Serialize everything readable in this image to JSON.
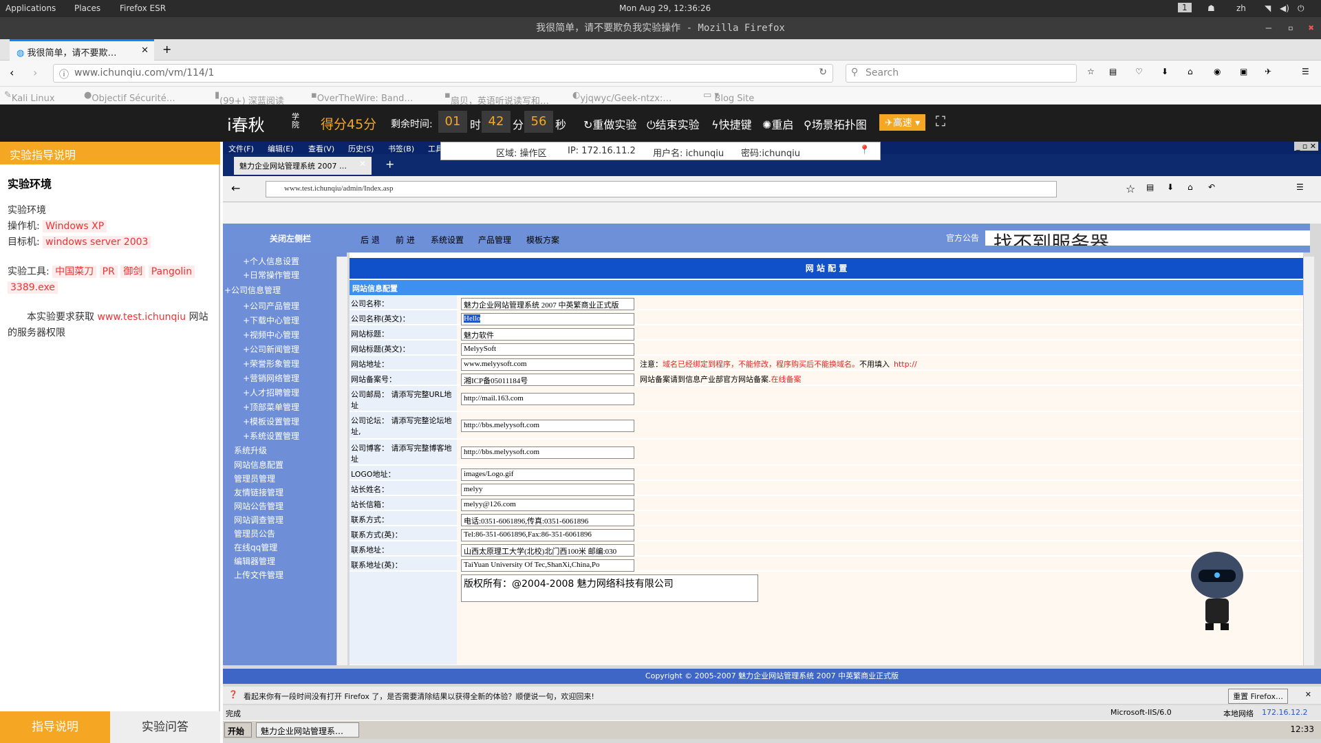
{
  "gnome": {
    "apps": "Applications",
    "places": "Places",
    "firefox": "Firefox ESR",
    "clock": "Mon Aug 29, 12:36:26",
    "workspace": "1",
    "lang": "zh"
  },
  "window_title": "我很简单，请不要欺负我实验操作 - Mozilla Firefox",
  "tab_label": "我很简单，请不要欺…",
  "url": "www.ichunqiu.com/vm/114/1",
  "search_placeholder": "Search",
  "bookmarks": [
    "Kali Linux",
    "Objectif Sécurité…",
    "(99+) 深蓝阅读",
    "OverTheWire: Band…",
    "扇贝，英语听说读写和…",
    "yjqwyc/Geek-ntzx:…",
    "Blog Site"
  ],
  "ichunqiu": {
    "logo": "i春秋",
    "logo_sub": "学院",
    "score": "得分45分",
    "remaining": "剩余时间:",
    "h": "01",
    "h_unit": "时",
    "m": "42",
    "m_unit": "分",
    "s": "56",
    "s_unit": "秒",
    "redo": "重做实验",
    "end": "结束实验",
    "shortcut": "快捷键",
    "restart": "重启",
    "topo": "场景拓扑图",
    "speed": "高速"
  },
  "left": {
    "header": "实验指导说明",
    "env_title": "实验环境",
    "env_label": "实验环境",
    "op_label": "操作机:",
    "op_value": "Windows XP",
    "target_label": "目标机:",
    "target_value": "windows server 2003",
    "tools_label": "实验工具:",
    "tools": [
      "中国菜刀",
      "PR",
      "御剑",
      "Pangolin",
      "3389.exe"
    ],
    "task_pre": "本实验要求获取",
    "task_link": "www.test.ichunqiu",
    "task_post": "网站的服务器权限",
    "tab_guide": "指导说明",
    "tab_qa": "实验问答"
  },
  "vm": {
    "menu": [
      "文件(F)",
      "编辑(E)",
      "查看(V)",
      "历史(S)",
      "书签(B)",
      "工具"
    ],
    "info": {
      "zone": "区域: 操作区",
      "ip": "IP: 172.16.11.2",
      "user": "用户名: ichunqiu",
      "pwd": "密码:ichunqiu"
    },
    "tab": "魅力企业网站管理系统 2007 …",
    "url": "www.test.ichunqiu/admin/Index.asp",
    "admin_top": {
      "close_left": "关闭左侧栏",
      "back": "后 退",
      "forward": "前 进",
      "sys": "系统设置",
      "product": "产品管理",
      "template": "模板方案",
      "notice": "官方公告",
      "marquee": "找不到服务器"
    },
    "sidebar": [
      "+个人信息设置",
      "+日常操作管理",
      "+公司信息管理",
      "+公司产品管理",
      "+下载中心管理",
      "+视频中心管理",
      "+公司新闻管理",
      "+荣誉形象管理",
      "+营销网络管理",
      "+人才招聘管理",
      "+顶部菜单管理",
      "+模板设置管理",
      "+系统设置管理",
      "系统升级",
      "网站信息配置",
      "管理员管理",
      "友情链接管理",
      "网站公告管理",
      "网站调查管理",
      "管理员公告",
      "在线qq管理",
      "编辑器管理",
      "上传文件管理"
    ],
    "title": "网 站 配 置",
    "section": "网站信息配置",
    "rows": [
      {
        "label": "公司名称：",
        "value": "魅力企业网站管理系统 2007 中英繁商业正式版"
      },
      {
        "label": "公司名称(英文)：",
        "value": "Hello"
      },
      {
        "label": "网站标题：",
        "value": "魅力软件"
      },
      {
        "label": "网站标题(英文)：",
        "value": "MelyySoft"
      },
      {
        "label": "网站地址：",
        "value": "www.melyysoft.com",
        "note": "注意：",
        "note_red": "域名已经绑定到程序，不能修改，程序购买后不能换域名。",
        "note2": "不用填入",
        "note_red2": "http://"
      },
      {
        "label": "网站备案号：",
        "value": "湘ICP备05011184号",
        "note": "网站备案请到信息产业部官方网站备案.",
        "note_red": "在线备案"
      },
      {
        "label": "公司邮局： 请添写完整URL地址",
        "value": "http://mail.163.com"
      },
      {
        "label": "公司论坛： 请添写完整论坛地址,",
        "value": "http://bbs.melyysoft.com"
      },
      {
        "label": "公司博客： 请添写完整博客地址",
        "value": "http://bbs.melyysoft.com"
      },
      {
        "label": "LOGO地址：",
        "value": "images/Logo.gif"
      },
      {
        "label": "站长姓名：",
        "value": "melyy"
      },
      {
        "label": "站长信箱：",
        "value": "melyy@126.com"
      },
      {
        "label": "联系方式：",
        "value": "电话:0351-6061896,传真:0351-6061896"
      },
      {
        "label": "联系方式(英)：",
        "value": "Tel:86-351-6061896,Fax:86-351-6061896"
      },
      {
        "label": "联系地址：",
        "value": "山西太原理工大学(北校)北门西100米 邮编:030"
      },
      {
        "label": "联系地址(英)：",
        "value": "TaiYuan University Of Tec,ShanXi,China,Po"
      }
    ],
    "copyright_box": "版权所有：@2004-2008 魅力网络科技有限公司",
    "footer": "Copyright © 2005-2007 魅力企业网站管理系统 2007 中英繁商业正式版",
    "notif": "看起来你有一段时间没有打开 Firefox 了，是否需要清除结果以获得全新的体验？顺便说一句，欢迎回来!",
    "notif_btn": "重置 Firefox…",
    "status": "完成",
    "status_server": "Microsoft-IIS/6.0",
    "status_net": "本地网络",
    "status_ip": "172.16.12.2",
    "start": "开始",
    "task_item": "魅力企业网站管理系…",
    "time": "12:33"
  }
}
